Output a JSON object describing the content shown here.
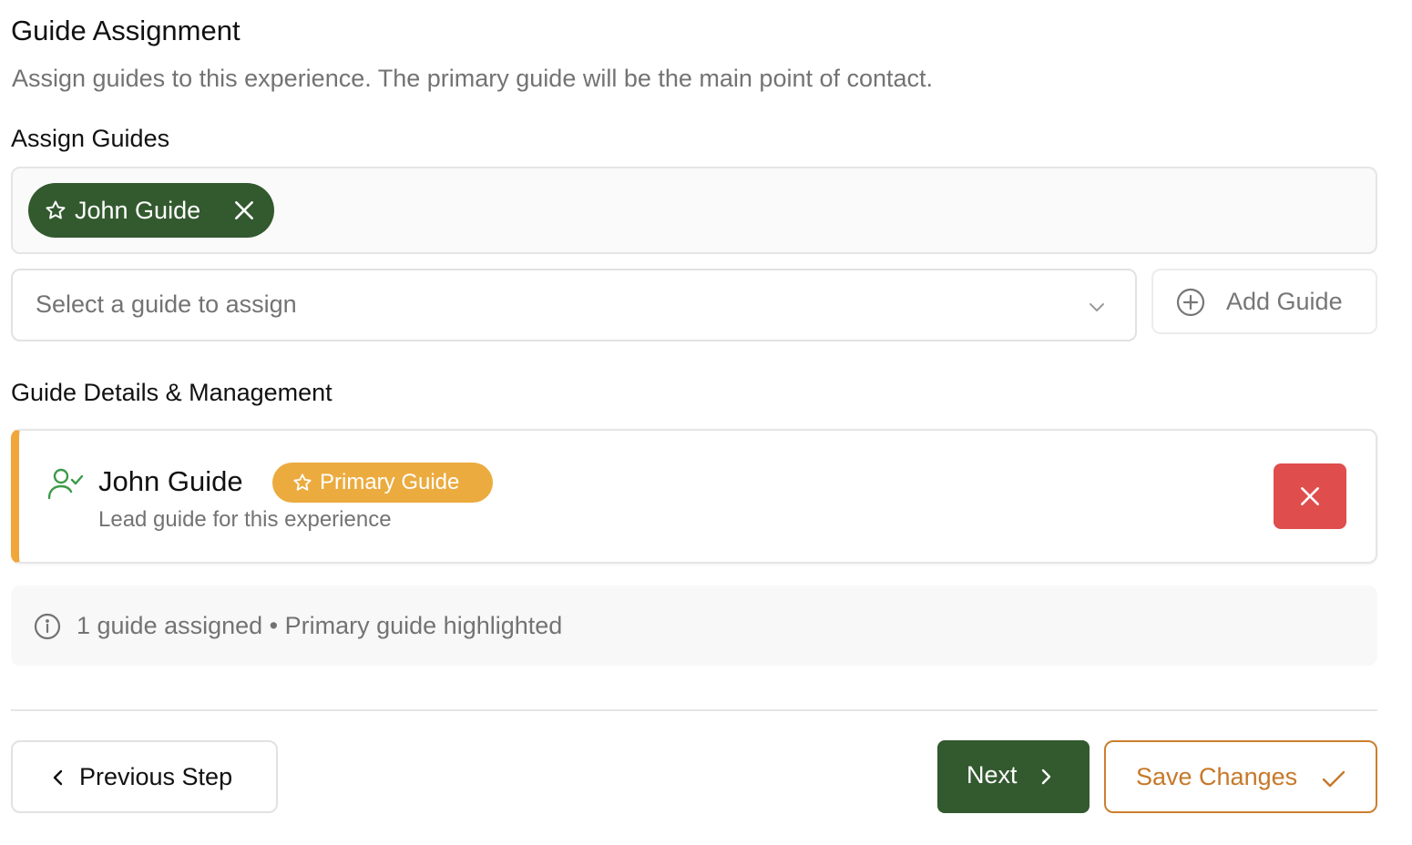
{
  "header": {
    "title": "Guide Assignment",
    "subtitle": "Assign guides to this experience. The primary guide will be the main point of contact."
  },
  "assign": {
    "label": "Assign Guides",
    "chips": [
      {
        "name": "John Guide",
        "icon": "star-icon"
      }
    ],
    "select_placeholder": "Select a guide to assign",
    "add_button_label": "Add Guide"
  },
  "details": {
    "label": "Guide Details & Management",
    "guides": [
      {
        "name": "John Guide",
        "badge": "Primary Guide",
        "description": "Lead guide for this experience",
        "icon": "user-check-icon"
      }
    ]
  },
  "info": {
    "text": "1 guide assigned • Primary guide highlighted"
  },
  "footer": {
    "previous_label": "Previous Step",
    "next_label": "Next",
    "save_label": "Save Changes"
  },
  "colors": {
    "primary_green": "#33592f",
    "accent_orange": "#ebab3f",
    "danger_red": "#df4d4d",
    "save_orange": "#c7782a",
    "muted_text": "#737373"
  }
}
